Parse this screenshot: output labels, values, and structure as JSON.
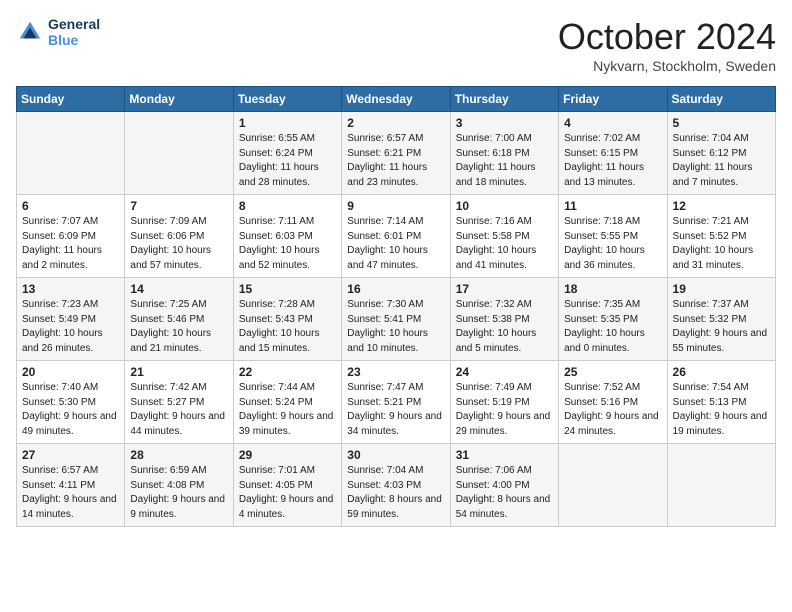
{
  "header": {
    "logo_line1": "General",
    "logo_line2": "Blue",
    "month_title": "October 2024",
    "location": "Nykvarn, Stockholm, Sweden"
  },
  "days_of_week": [
    "Sunday",
    "Monday",
    "Tuesday",
    "Wednesday",
    "Thursday",
    "Friday",
    "Saturday"
  ],
  "weeks": [
    [
      {
        "day": "",
        "sunrise": "",
        "sunset": "",
        "daylight": ""
      },
      {
        "day": "",
        "sunrise": "",
        "sunset": "",
        "daylight": ""
      },
      {
        "day": "1",
        "sunrise": "Sunrise: 6:55 AM",
        "sunset": "Sunset: 6:24 PM",
        "daylight": "Daylight: 11 hours and 28 minutes."
      },
      {
        "day": "2",
        "sunrise": "Sunrise: 6:57 AM",
        "sunset": "Sunset: 6:21 PM",
        "daylight": "Daylight: 11 hours and 23 minutes."
      },
      {
        "day": "3",
        "sunrise": "Sunrise: 7:00 AM",
        "sunset": "Sunset: 6:18 PM",
        "daylight": "Daylight: 11 hours and 18 minutes."
      },
      {
        "day": "4",
        "sunrise": "Sunrise: 7:02 AM",
        "sunset": "Sunset: 6:15 PM",
        "daylight": "Daylight: 11 hours and 13 minutes."
      },
      {
        "day": "5",
        "sunrise": "Sunrise: 7:04 AM",
        "sunset": "Sunset: 6:12 PM",
        "daylight": "Daylight: 11 hours and 7 minutes."
      }
    ],
    [
      {
        "day": "6",
        "sunrise": "Sunrise: 7:07 AM",
        "sunset": "Sunset: 6:09 PM",
        "daylight": "Daylight: 11 hours and 2 minutes."
      },
      {
        "day": "7",
        "sunrise": "Sunrise: 7:09 AM",
        "sunset": "Sunset: 6:06 PM",
        "daylight": "Daylight: 10 hours and 57 minutes."
      },
      {
        "day": "8",
        "sunrise": "Sunrise: 7:11 AM",
        "sunset": "Sunset: 6:03 PM",
        "daylight": "Daylight: 10 hours and 52 minutes."
      },
      {
        "day": "9",
        "sunrise": "Sunrise: 7:14 AM",
        "sunset": "Sunset: 6:01 PM",
        "daylight": "Daylight: 10 hours and 47 minutes."
      },
      {
        "day": "10",
        "sunrise": "Sunrise: 7:16 AM",
        "sunset": "Sunset: 5:58 PM",
        "daylight": "Daylight: 10 hours and 41 minutes."
      },
      {
        "day": "11",
        "sunrise": "Sunrise: 7:18 AM",
        "sunset": "Sunset: 5:55 PM",
        "daylight": "Daylight: 10 hours and 36 minutes."
      },
      {
        "day": "12",
        "sunrise": "Sunrise: 7:21 AM",
        "sunset": "Sunset: 5:52 PM",
        "daylight": "Daylight: 10 hours and 31 minutes."
      }
    ],
    [
      {
        "day": "13",
        "sunrise": "Sunrise: 7:23 AM",
        "sunset": "Sunset: 5:49 PM",
        "daylight": "Daylight: 10 hours and 26 minutes."
      },
      {
        "day": "14",
        "sunrise": "Sunrise: 7:25 AM",
        "sunset": "Sunset: 5:46 PM",
        "daylight": "Daylight: 10 hours and 21 minutes."
      },
      {
        "day": "15",
        "sunrise": "Sunrise: 7:28 AM",
        "sunset": "Sunset: 5:43 PM",
        "daylight": "Daylight: 10 hours and 15 minutes."
      },
      {
        "day": "16",
        "sunrise": "Sunrise: 7:30 AM",
        "sunset": "Sunset: 5:41 PM",
        "daylight": "Daylight: 10 hours and 10 minutes."
      },
      {
        "day": "17",
        "sunrise": "Sunrise: 7:32 AM",
        "sunset": "Sunset: 5:38 PM",
        "daylight": "Daylight: 10 hours and 5 minutes."
      },
      {
        "day": "18",
        "sunrise": "Sunrise: 7:35 AM",
        "sunset": "Sunset: 5:35 PM",
        "daylight": "Daylight: 10 hours and 0 minutes."
      },
      {
        "day": "19",
        "sunrise": "Sunrise: 7:37 AM",
        "sunset": "Sunset: 5:32 PM",
        "daylight": "Daylight: 9 hours and 55 minutes."
      }
    ],
    [
      {
        "day": "20",
        "sunrise": "Sunrise: 7:40 AM",
        "sunset": "Sunset: 5:30 PM",
        "daylight": "Daylight: 9 hours and 49 minutes."
      },
      {
        "day": "21",
        "sunrise": "Sunrise: 7:42 AM",
        "sunset": "Sunset: 5:27 PM",
        "daylight": "Daylight: 9 hours and 44 minutes."
      },
      {
        "day": "22",
        "sunrise": "Sunrise: 7:44 AM",
        "sunset": "Sunset: 5:24 PM",
        "daylight": "Daylight: 9 hours and 39 minutes."
      },
      {
        "day": "23",
        "sunrise": "Sunrise: 7:47 AM",
        "sunset": "Sunset: 5:21 PM",
        "daylight": "Daylight: 9 hours and 34 minutes."
      },
      {
        "day": "24",
        "sunrise": "Sunrise: 7:49 AM",
        "sunset": "Sunset: 5:19 PM",
        "daylight": "Daylight: 9 hours and 29 minutes."
      },
      {
        "day": "25",
        "sunrise": "Sunrise: 7:52 AM",
        "sunset": "Sunset: 5:16 PM",
        "daylight": "Daylight: 9 hours and 24 minutes."
      },
      {
        "day": "26",
        "sunrise": "Sunrise: 7:54 AM",
        "sunset": "Sunset: 5:13 PM",
        "daylight": "Daylight: 9 hours and 19 minutes."
      }
    ],
    [
      {
        "day": "27",
        "sunrise": "Sunrise: 6:57 AM",
        "sunset": "Sunset: 4:11 PM",
        "daylight": "Daylight: 9 hours and 14 minutes."
      },
      {
        "day": "28",
        "sunrise": "Sunrise: 6:59 AM",
        "sunset": "Sunset: 4:08 PM",
        "daylight": "Daylight: 9 hours and 9 minutes."
      },
      {
        "day": "29",
        "sunrise": "Sunrise: 7:01 AM",
        "sunset": "Sunset: 4:05 PM",
        "daylight": "Daylight: 9 hours and 4 minutes."
      },
      {
        "day": "30",
        "sunrise": "Sunrise: 7:04 AM",
        "sunset": "Sunset: 4:03 PM",
        "daylight": "Daylight: 8 hours and 59 minutes."
      },
      {
        "day": "31",
        "sunrise": "Sunrise: 7:06 AM",
        "sunset": "Sunset: 4:00 PM",
        "daylight": "Daylight: 8 hours and 54 minutes."
      },
      {
        "day": "",
        "sunrise": "",
        "sunset": "",
        "daylight": ""
      },
      {
        "day": "",
        "sunrise": "",
        "sunset": "",
        "daylight": ""
      }
    ]
  ]
}
